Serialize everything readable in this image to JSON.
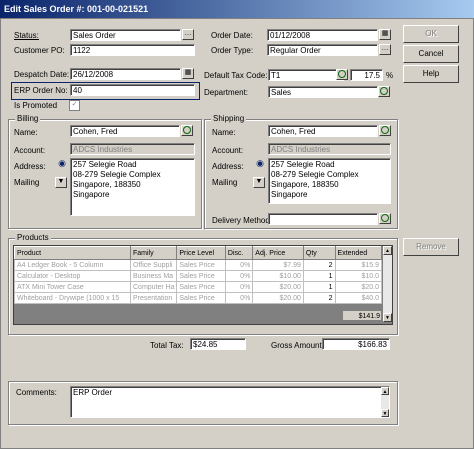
{
  "window": {
    "title": "Edit Sales Order #: 001-00-021521"
  },
  "header": {
    "status_label": "Status:",
    "status_value": "Sales Order",
    "customer_po_label": "Customer PO:",
    "customer_po_value": "1122",
    "order_date_label": "Order Date:",
    "order_date_value": "01/12/2008",
    "order_type_label": "Order Type:",
    "order_type_value": "Regular Order",
    "despatch_date_label": "Despatch Date:",
    "despatch_date_value": "26/12/2008",
    "erp_order_label": "ERP Order No:",
    "erp_order_value": "40",
    "is_promoted_label": "Is Promoted",
    "default_tax_label": "Default Tax Code:",
    "default_tax_value": "T1",
    "tax_rate_value": "17.5",
    "percent_sign": "%",
    "department_label": "Department:",
    "department_value": "Sales"
  },
  "billing": {
    "title": "Billing",
    "name_label": "Name:",
    "name_value": "Cohen, Fred",
    "account_label": "Account:",
    "account_value": "ADCS Industries",
    "address_label": "Address:",
    "address_lines": [
      "257 Selegie Road",
      "08-279 Selegie Complex",
      "Singapore,  188350",
      "Singapore"
    ],
    "mailing_label": "Mailing"
  },
  "shipping": {
    "title": "Shipping",
    "name_label": "Name:",
    "name_value": "Cohen, Fred",
    "account_label": "Account:",
    "account_value": "ADCS Industries",
    "address_label": "Address:",
    "address_lines": [
      "257 Selegie Road",
      "08-279 Selegie Complex",
      "Singapore,  188350",
      "Singapore"
    ],
    "mailing_label": "Mailing",
    "delivery_method_label": "Delivery Method:"
  },
  "products": {
    "title": "Products",
    "columns": [
      "Product",
      "Family",
      "Price Level",
      "Disc.",
      "Adj. Price",
      "Qty",
      "Extended"
    ],
    "rows": [
      [
        "A4 Ledger Book - 5 Column",
        "Office Suppli",
        "Sales Price",
        "0%",
        "$7.99",
        "2",
        "$15.9"
      ],
      [
        "Calculator - Desktop",
        "Business Ma",
        "Sales Price",
        "0%",
        "$10.00",
        "1",
        "$10.0"
      ],
      [
        "ATX Mini Tower Case",
        "Computer Ha",
        "Sales Price",
        "0%",
        "$20.00",
        "1",
        "$20.0"
      ],
      [
        "Whiteboard - Drywipe (1000 x 15",
        "Presentation",
        "Sales Price",
        "0%",
        "$20.00",
        "2",
        "$40.0"
      ]
    ],
    "total_extended": "$141.9"
  },
  "totals": {
    "total_tax_label": "Total Tax:",
    "total_tax_value": "$24.85",
    "gross_amount_label": "Gross Amount:",
    "gross_amount_value": "$166.83"
  },
  "comments": {
    "label": "Comments:",
    "value": "ERP Order"
  },
  "buttons": {
    "ok": "OK",
    "cancel": "Cancel",
    "help": "Help",
    "remove": "Remove"
  }
}
